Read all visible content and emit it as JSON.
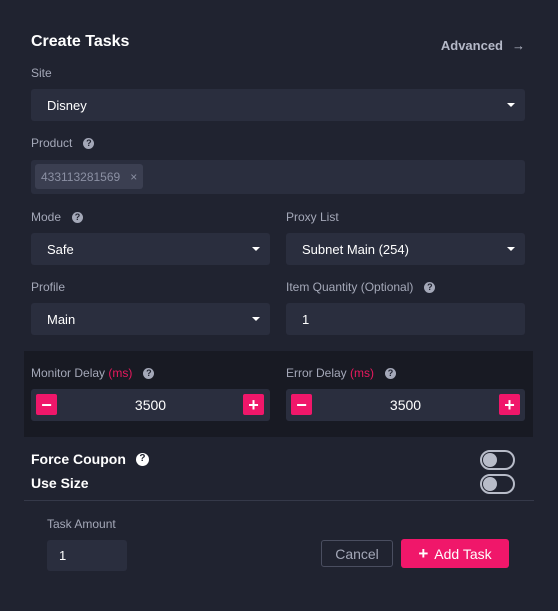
{
  "header": {
    "title": "Create Tasks",
    "advanced_label": "Advanced"
  },
  "site": {
    "label": "Site",
    "value": "Disney"
  },
  "product": {
    "label": "Product",
    "tags": [
      "433113281569"
    ]
  },
  "mode": {
    "label": "Mode",
    "value": "Safe"
  },
  "proxy_list": {
    "label": "Proxy List",
    "value": "Subnet Main (254)"
  },
  "profile": {
    "label": "Profile",
    "value": "Main"
  },
  "item_quantity": {
    "label": "Item Quantity (Optional)",
    "value": "1"
  },
  "monitor_delay": {
    "label": "Monitor Delay",
    "unit": "(ms)",
    "value": "3500"
  },
  "error_delay": {
    "label": "Error Delay",
    "unit": "(ms)",
    "value": "3500"
  },
  "force_coupon": {
    "label": "Force Coupon",
    "enabled": false
  },
  "use_size": {
    "label": "Use Size",
    "enabled": false
  },
  "footer": {
    "task_amount_label": "Task Amount",
    "task_amount_value": "1",
    "cancel_label": "Cancel",
    "add_task_label": "Add Task"
  },
  "colors": {
    "accent": "#f0176a",
    "background": "#202330",
    "field": "#2a2e3e"
  }
}
